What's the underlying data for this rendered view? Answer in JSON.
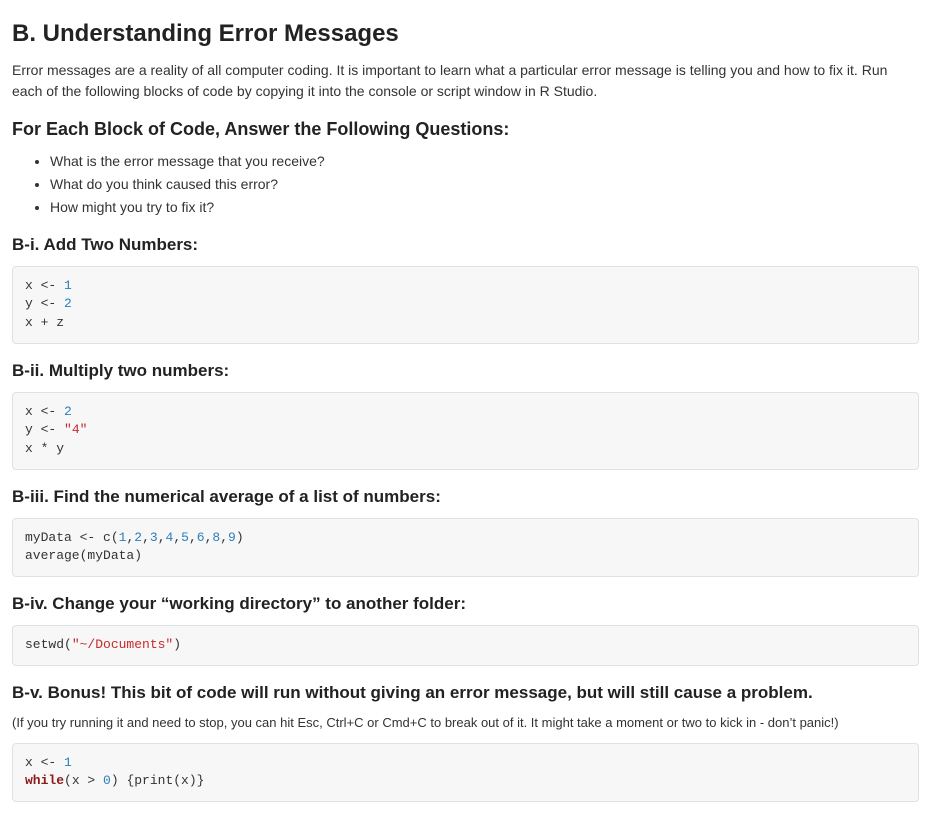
{
  "title": "B. Understanding Error Messages",
  "intro": "Error messages are a reality of all computer coding. It is important to learn what a particular error message is telling you and how to fix it. Run each of the following blocks of code by copying it into the console or script window in R Studio.",
  "questions_heading": "For Each Block of Code, Answer the Following Questions:",
  "questions": [
    "What is the error message that you receive?",
    "What do you think caused this error?",
    "How might you try to fix it?"
  ],
  "blocks": {
    "bi": {
      "heading": "B-i. Add Two Numbers:",
      "code": {
        "line1_pre": "x <- ",
        "line1_num": "1",
        "line2_pre": "y <- ",
        "line2_num": "2",
        "line3": "x + z"
      }
    },
    "bii": {
      "heading": "B-ii. Multiply two numbers:",
      "code": {
        "line1_pre": "x <- ",
        "line1_num": "2",
        "line2_pre": "y <- ",
        "line2_str": "\"4\"",
        "line3": "x * y"
      }
    },
    "biii": {
      "heading": "B-iii. Find the numerical average of a list of numbers:",
      "code": {
        "line1_pre": "myData <- c(",
        "n1": "1",
        "c1": ",",
        "n2": "2",
        "c2": ",",
        "n3": "3",
        "c3": ",",
        "n4": "4",
        "c4": ",",
        "n5": "5",
        "c5": ",",
        "n6": "6",
        "c6": ",",
        "n7": "8",
        "c7": ",",
        "n8": "9",
        "line1_post": ")",
        "line2": "average(myData)"
      }
    },
    "biv": {
      "heading": "B-iv. Change your “working directory” to another folder:",
      "code": {
        "pre": "setwd(",
        "str": "\"~/Documents\"",
        "post": ")"
      }
    },
    "bv": {
      "heading": "B-v. Bonus! This bit of code will run without giving an error message, but will still cause a problem.",
      "note": "(If you try running it and need to stop, you can hit Esc, Ctrl+C or Cmd+C to break out of it. It might take a moment or two to kick in - don’t panic!)",
      "code": {
        "line1_pre": "x <- ",
        "line1_num": "1",
        "line2_kw": "while",
        "line2_mid": "(x > ",
        "line2_num": "0",
        "line2_post": ") {print(x)}"
      }
    }
  }
}
